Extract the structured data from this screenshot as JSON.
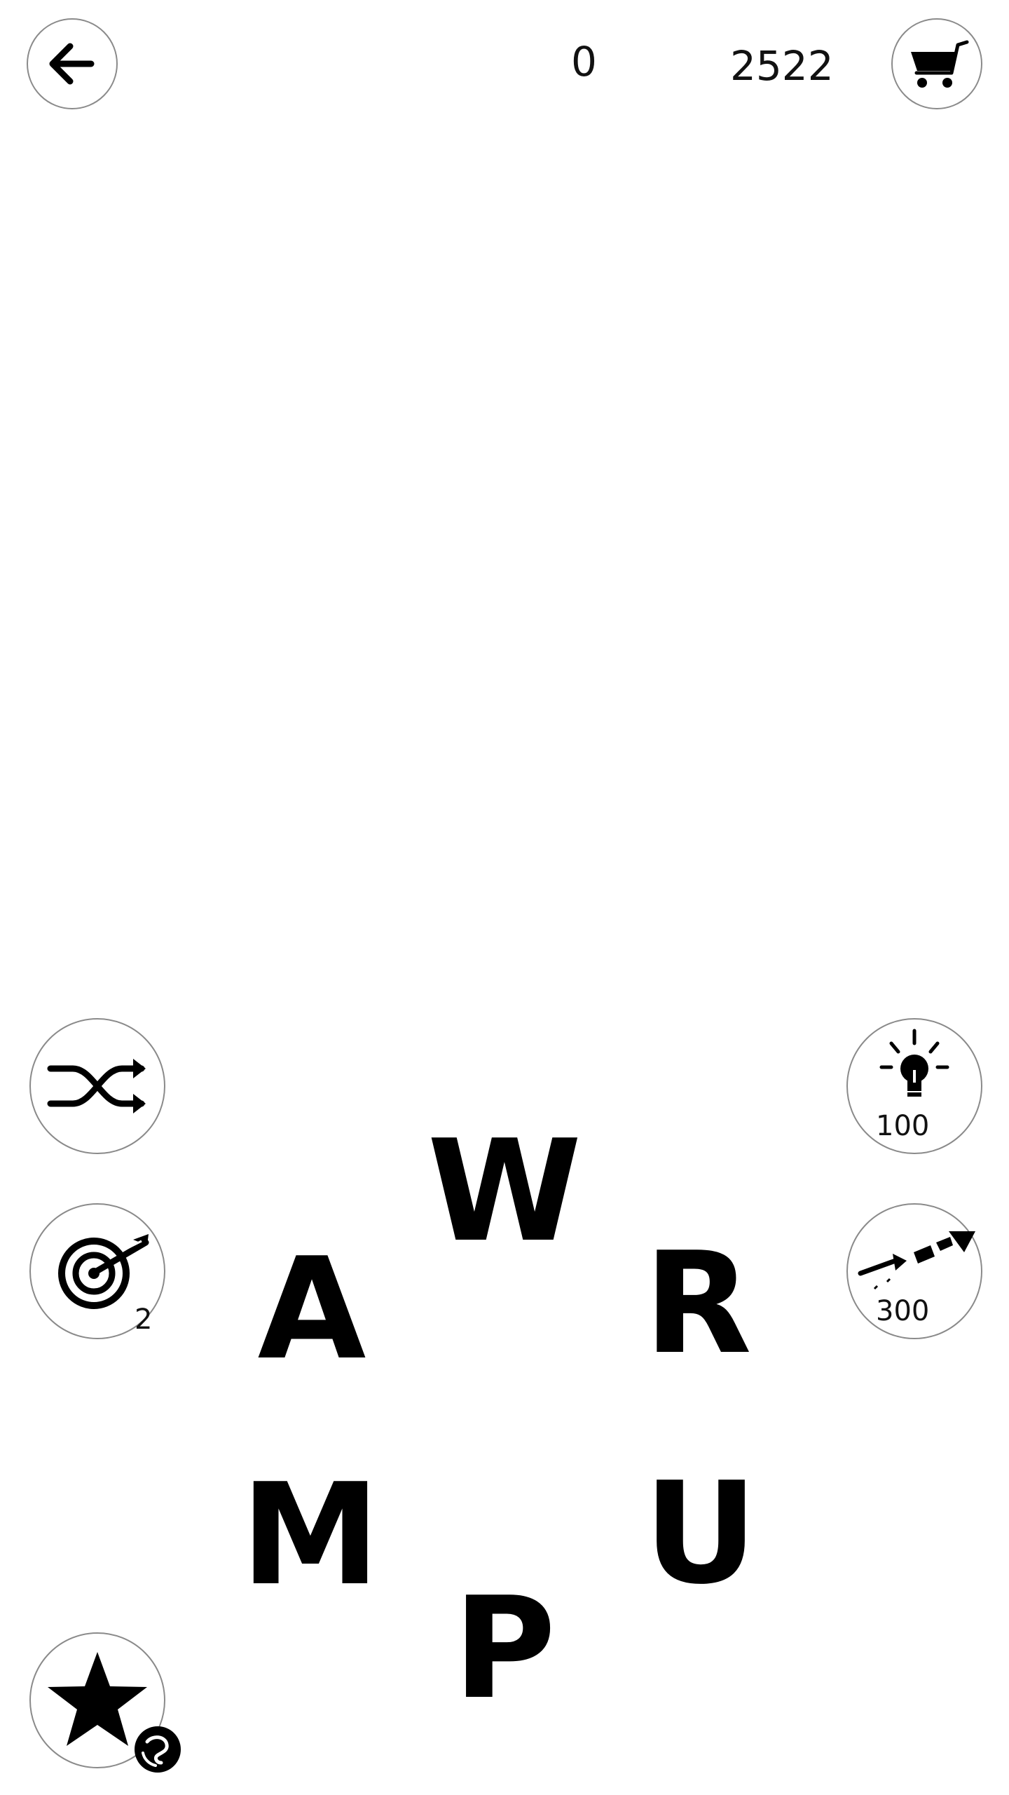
{
  "header": {
    "back_icon": "arrow-left-icon",
    "found_words": "0",
    "coins": "2522",
    "shop_icon": "shopping-cart-icon"
  },
  "tools": {
    "shuffle": {
      "icon": "shuffle-icon"
    },
    "target": {
      "icon": "target-arrow-icon",
      "count": "2"
    },
    "hint": {
      "icon": "lightbulb-icon",
      "cost": "100"
    },
    "rocket": {
      "icon": "firework-rocket-icon",
      "cost": "300"
    },
    "favorite": {
      "icon": "star-icon",
      "badge_icon": "video-reward-icon"
    }
  },
  "wheel": {
    "letters": [
      "W",
      "R",
      "U",
      "P",
      "M",
      "A"
    ]
  }
}
